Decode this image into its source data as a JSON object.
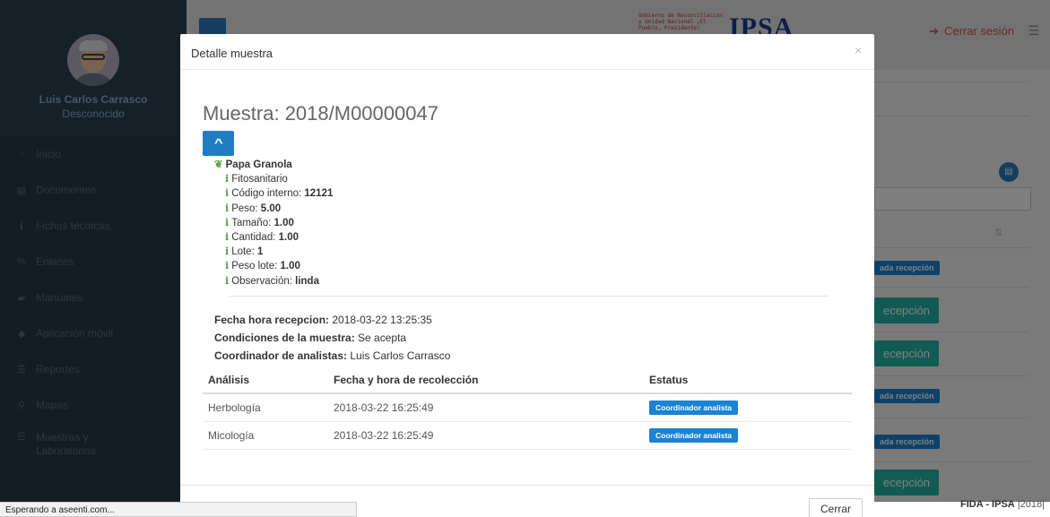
{
  "user": {
    "name": "Luis Carlos Carrasco",
    "role": "Desconocido"
  },
  "sidebar": {
    "items": [
      {
        "icon": "home-icon",
        "glyph": "⌂",
        "label": "Inicio"
      },
      {
        "icon": "document-icon",
        "glyph": "▤",
        "label": "Documentos"
      },
      {
        "icon": "info-icon",
        "glyph": "ℹ",
        "label": "Fichas técnicas"
      },
      {
        "icon": "link-icon",
        "glyph": "%",
        "label": "Enlaces"
      },
      {
        "icon": "book-icon",
        "glyph": "▰",
        "label": "Manuales"
      },
      {
        "icon": "mobile-icon",
        "glyph": "◆",
        "label": "Aplicación móvil"
      },
      {
        "icon": "list-icon",
        "glyph": "☰",
        "label": "Reportes"
      },
      {
        "icon": "map-marker-icon",
        "glyph": "⚲",
        "label": "Mapas"
      },
      {
        "icon": "list-icon",
        "glyph": "☰",
        "label": "Muestras y Laboratorios"
      }
    ]
  },
  "header": {
    "logo_small": "Gobierno de Reconciliación y Unidad Nacional ¡El Pueblo, Presidente!",
    "logo_text": "IPSA",
    "logout_label": "Cerrar sesión"
  },
  "background": {
    "badge_label": "ada recepción",
    "button_label": "ecepción"
  },
  "footer": {
    "brand": "FIDA - IPSA",
    "year": "|2018|"
  },
  "status_bar": "Esperando a aseenti.com...",
  "modal": {
    "title": "Detalle muestra",
    "close_x": "×",
    "sample_title": "Muestra: 2018/M00000047",
    "product": {
      "name": "Papa Granola",
      "category": "Fitosanitario",
      "fields": [
        {
          "label": "Código interno: ",
          "value": "12121"
        },
        {
          "label": "Peso: ",
          "value": "5.00"
        },
        {
          "label": "Tamaño: ",
          "value": "1.00"
        },
        {
          "label": "Cantidad: ",
          "value": "1.00"
        },
        {
          "label": "Lote: ",
          "value": "1"
        },
        {
          "label": "Peso lote: ",
          "value": "1.00"
        },
        {
          "label": "Observación: ",
          "value": "linda"
        }
      ]
    },
    "reception": {
      "datetime_label": "Fecha hora recepcion:",
      "datetime_value": " 2018-03-22 13:25:35",
      "conditions_label": "Condiciones de la muestra:",
      "conditions_value": " Se acepta",
      "coordinator_label": "Coordinador de analistas:",
      "coordinator_value": " Luis Carlos Carrasco"
    },
    "table": {
      "headers": [
        "Análisis",
        "Fecha y hora de recolección",
        "Estatus"
      ],
      "rows": [
        {
          "analysis": "Herbología",
          "datetime": "2018-03-22 16:25:49",
          "status": "Coordinador analista"
        },
        {
          "analysis": "Micología",
          "datetime": "2018-03-22 16:25:49",
          "status": "Coordinador analista"
        }
      ]
    },
    "close_button": "Cerrar"
  },
  "colors": {
    "primary": "#1c82d2",
    "teal": "#23b7a7",
    "danger": "#d9534f",
    "sidebar": "#2a3a48",
    "leaf": "#5aa53a"
  }
}
